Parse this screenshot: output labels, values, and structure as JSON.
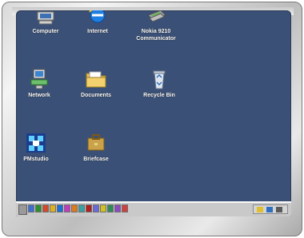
{
  "desktop": {
    "background_color": "#3a5076",
    "icons": [
      {
        "label_lines": [
          "Computer"
        ],
        "icon": "computer-icon"
      },
      {
        "label_lines": [
          "Internet"
        ],
        "icon": "internet-explorer-icon"
      },
      {
        "label_lines": [
          "Nokia 9210",
          "Communicator"
        ],
        "icon": "nokia-communicator-icon"
      },
      {
        "label_lines": [
          "Network"
        ],
        "icon": "network-icon"
      },
      {
        "label_lines": [
          "Documents"
        ],
        "icon": "documents-folder-icon"
      },
      {
        "label_lines": [
          "Recycle Bin"
        ],
        "icon": "recycle-bin-icon"
      },
      {
        "label_lines": [
          "PMstudio"
        ],
        "icon": "pmstudio-icon"
      },
      {
        "label_lines": [
          "Briefcase"
        ],
        "icon": "briefcase-icon"
      }
    ]
  },
  "taskbar": {
    "quick_launch_colors": [
      "#3b6fd1",
      "#2f8f2f",
      "#d24a2a",
      "#e0b020",
      "#1c6fd6",
      "#c23bc2",
      "#e07a1a",
      "#3aa0a0",
      "#b02020",
      "#6a6ad8",
      "#d0c020",
      "#2e8b57",
      "#8a4ac0",
      "#d04040"
    ]
  }
}
